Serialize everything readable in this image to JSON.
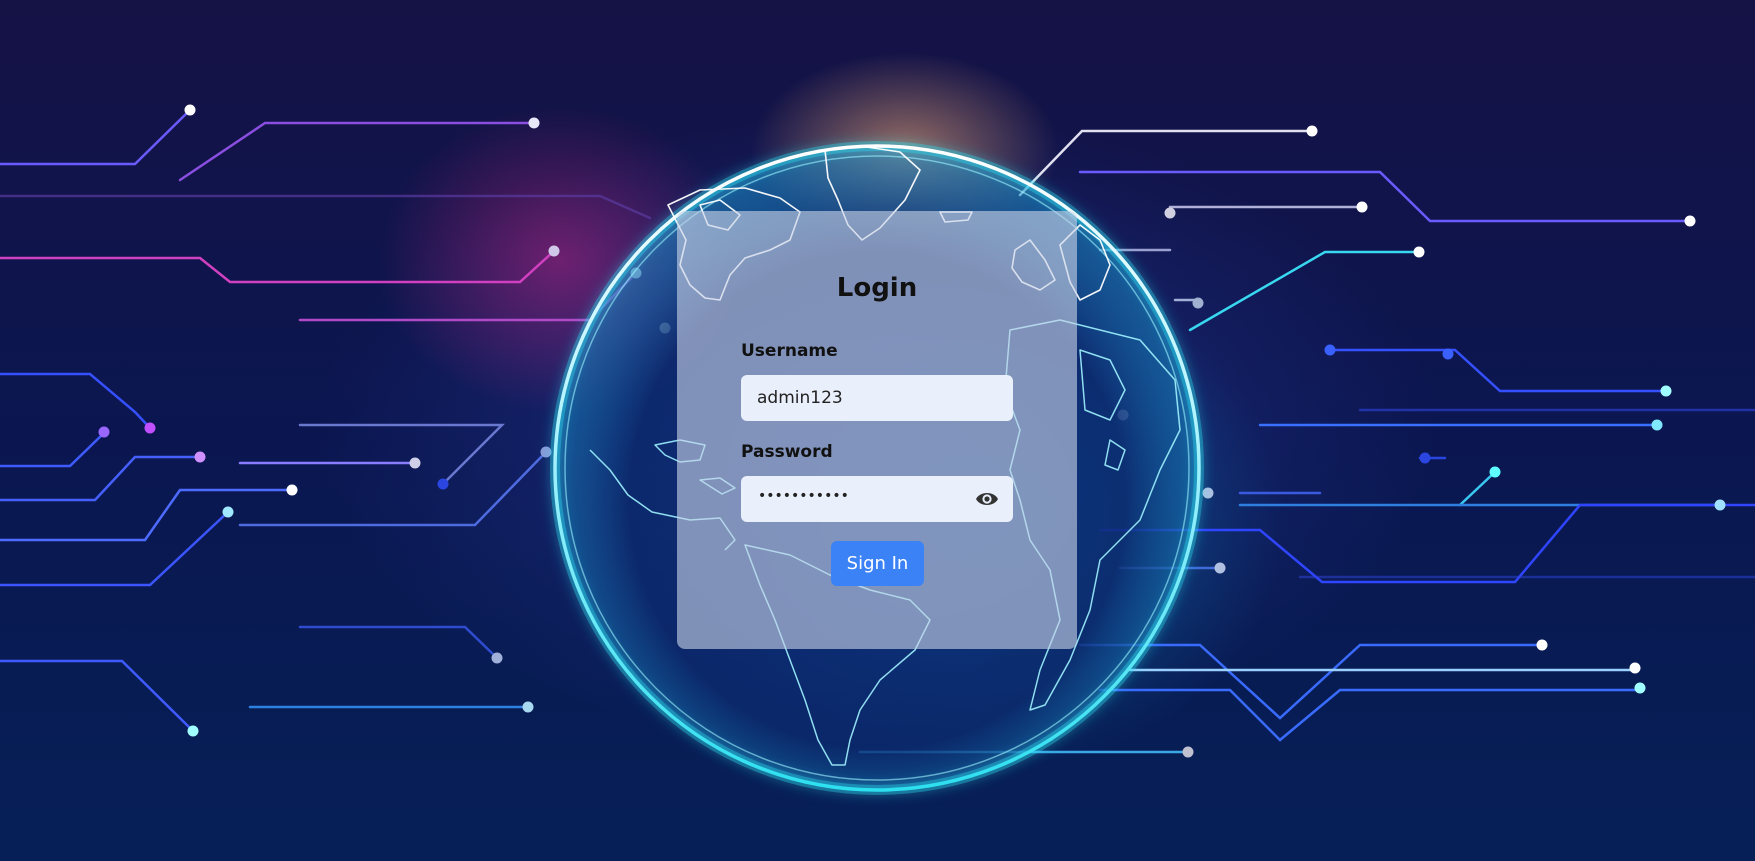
{
  "login": {
    "title": "Login",
    "username_label": "Username",
    "username_value": "admin123",
    "password_label": "Password",
    "password_masked": "•••••••••••",
    "password_toggle_icon": "eye-icon",
    "submit_label": "Sign In"
  },
  "background": {
    "artwork": "globe-circuit-illustration",
    "accent_cyan": "#3ee6f0",
    "accent_magenta": "#d23cc8",
    "accent_blue": "#2f4bff",
    "button_color": "#3b82f6"
  }
}
